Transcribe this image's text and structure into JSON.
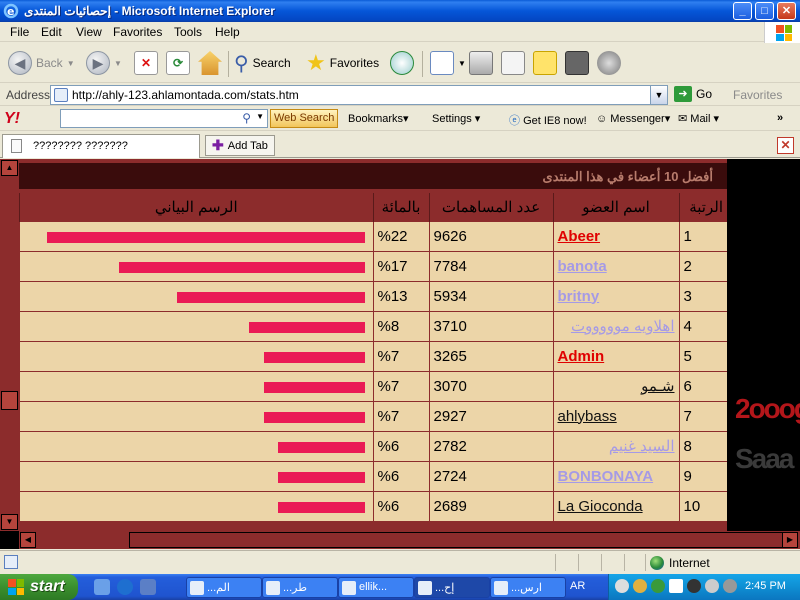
{
  "window": {
    "title": "إحصائيات المنتدى - Microsoft Internet Explorer",
    "controls": {
      "minimize": "_",
      "maximize": "□",
      "close": "✕"
    }
  },
  "menu": [
    "File",
    "Edit",
    "View",
    "Favorites",
    "Tools",
    "Help"
  ],
  "toolbar": {
    "back": "Back",
    "search": "Search",
    "favorites": "Favorites"
  },
  "address": {
    "label": "Address",
    "url": "http://ahly-123.ahlamontada.com/stats.htm",
    "go": "Go",
    "favorites": "Favorites"
  },
  "yahoo": {
    "logo": "Y!",
    "search_value": "",
    "search_button": "Web Search",
    "bookmarks": "Bookmarks",
    "settings": "Settings",
    "get_ie8": "Get IE8 now!",
    "messenger": "Messenger",
    "mail": "Mail"
  },
  "tabs": {
    "current": "???????? ???????",
    "add": "Add Tab"
  },
  "stats": {
    "title": "أفضل 10 أعضاء في هذا المنتدى",
    "headers": {
      "rank": "الرتبة",
      "name": "اسم العضو",
      "count": "عدد المساهمات",
      "percent": "بالمائة",
      "chart": "الرسم البياني"
    },
    "rows": [
      {
        "rank": "1",
        "name": "Abeer",
        "count": "9626",
        "percent": "%22",
        "pct": 22,
        "style": "red"
      },
      {
        "rank": "2",
        "name": "banota",
        "count": "7784",
        "percent": "%17",
        "pct": 17,
        "style": "lavb"
      },
      {
        "rank": "3",
        "name": "britny",
        "count": "5934",
        "percent": "%13",
        "pct": 13,
        "style": "lavb"
      },
      {
        "rank": "4",
        "name": "اهلاويه موووووت",
        "count": "3710",
        "percent": "%8",
        "pct": 8,
        "style": "lav"
      },
      {
        "rank": "5",
        "name": "Admin",
        "count": "3265",
        "percent": "%7",
        "pct": 7,
        "style": "red"
      },
      {
        "rank": "6",
        "name": "شـمو",
        "count": "3070",
        "percent": "%7",
        "pct": 7,
        "style": "dark"
      },
      {
        "rank": "7",
        "name": "ahlybass",
        "count": "2927",
        "percent": "%7",
        "pct": 7,
        "style": "dark"
      },
      {
        "rank": "8",
        "name": "السيد غنيم",
        "count": "2782",
        "percent": "%6",
        "pct": 6,
        "style": "lav"
      },
      {
        "rank": "9",
        "name": "BONBONAYA",
        "count": "2724",
        "percent": "%6",
        "pct": 6,
        "style": "lavb"
      },
      {
        "rank": "10",
        "name": "La Gioconda",
        "count": "2689",
        "percent": "%6",
        "pct": 6,
        "style": "dark"
      }
    ]
  },
  "status": {
    "zone": "Internet"
  },
  "taskbar": {
    "start": "start",
    "tasks": [
      "...الم",
      "...طر",
      "ellik...",
      "...إح",
      "...ارس"
    ],
    "active_task": 3,
    "language": "AR",
    "clock": "2:45 PM"
  },
  "colors": {
    "bar": "#ea1a55",
    "row_bg": "#ecd5a8",
    "header_bg": "#8c2c2c",
    "title_bar": "#3a0c0c"
  }
}
